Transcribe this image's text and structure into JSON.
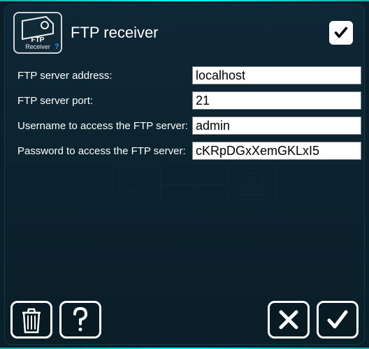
{
  "header": {
    "title": "FTP receiver",
    "icon_label_top": "FTP",
    "icon_label_bottom": "Receiver",
    "flag_enabled": true
  },
  "fields": {
    "address": {
      "label": "FTP server address:",
      "value": "localhost"
    },
    "port": {
      "label": "FTP server port:",
      "value": "21"
    },
    "username": {
      "label": "Username to access the FTP server:",
      "value": "admin"
    },
    "password": {
      "label": "Password to access the FTP server:",
      "value": "cKRpDGxXemGKLxI5"
    }
  },
  "icons": {
    "trash": "trash-icon",
    "help": "help-icon",
    "cancel": "close-icon",
    "ok": "check-icon"
  }
}
